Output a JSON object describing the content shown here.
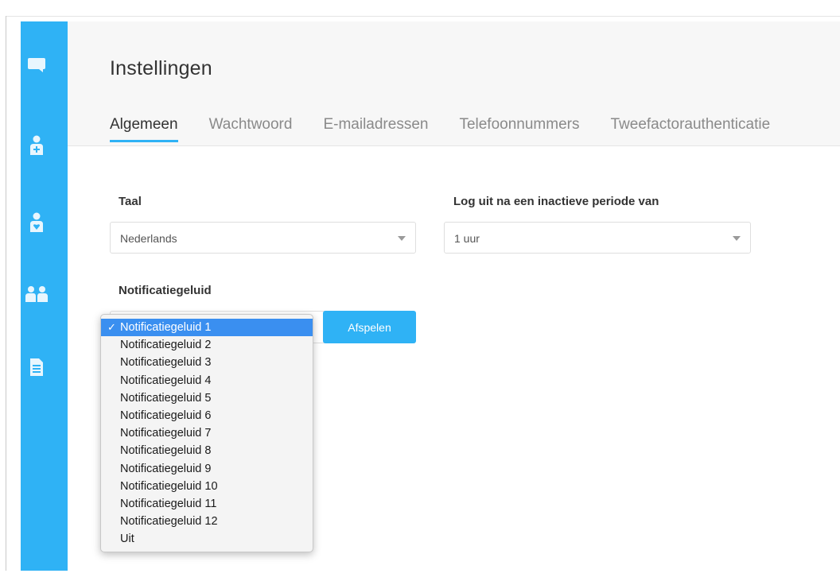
{
  "page": {
    "title": "Instellingen"
  },
  "tabs": [
    {
      "label": "Algemeen",
      "active": true
    },
    {
      "label": "Wachtwoord",
      "active": false
    },
    {
      "label": "E-mailadressen",
      "active": false
    },
    {
      "label": "Telefoonnummers",
      "active": false
    },
    {
      "label": "Tweefactorauthenticatie",
      "active": false
    }
  ],
  "sidebar": {
    "items": [
      {
        "icon": "chat-icon"
      },
      {
        "icon": "user-add-icon"
      },
      {
        "icon": "user-badge-icon"
      },
      {
        "icon": "users-icon"
      },
      {
        "icon": "document-icon"
      }
    ]
  },
  "language": {
    "label": "Taal",
    "value": "Nederlands"
  },
  "logout": {
    "label": "Log uit na een inactieve periode van",
    "value": "1 uur"
  },
  "notification": {
    "label": "Notificatiegeluid",
    "play_label": "Afspelen",
    "check_mark": "✓",
    "options": [
      "Notificatiegeluid 1",
      "Notificatiegeluid 2",
      "Notificatiegeluid 3",
      "Notificatiegeluid 4",
      "Notificatiegeluid 5",
      "Notificatiegeluid 6",
      "Notificatiegeluid 7",
      "Notificatiegeluid 8",
      "Notificatiegeluid 9",
      "Notificatiegeluid 10",
      "Notificatiegeluid 11",
      "Notificatiegeluid 12",
      "Uit"
    ],
    "selected_index": 0
  },
  "colors": {
    "accent": "#2fb2f5",
    "selection": "#3a8ff0"
  }
}
